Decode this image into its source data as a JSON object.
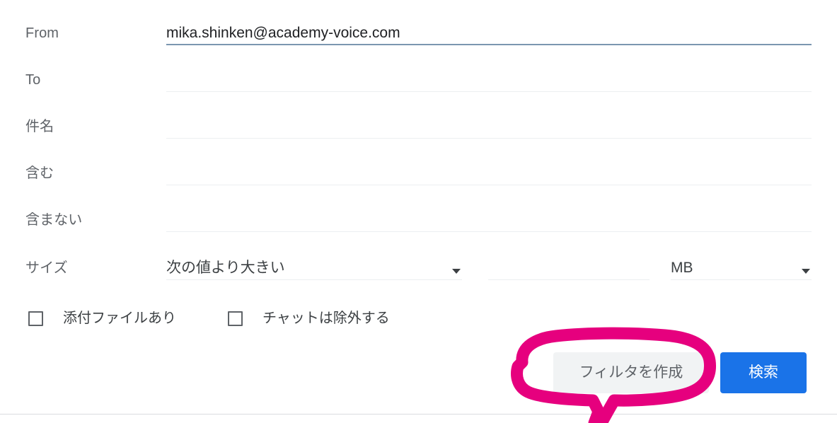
{
  "form": {
    "rows": [
      {
        "label": "From",
        "value": "mika.shinken@academy-voice.com",
        "placeholder": "",
        "focused": true
      },
      {
        "label": "To",
        "value": "",
        "placeholder": "",
        "focused": false
      },
      {
        "label": "件名",
        "value": "",
        "placeholder": "",
        "focused": false
      },
      {
        "label": "含む",
        "value": "",
        "placeholder": "",
        "focused": false
      },
      {
        "label": "含まない",
        "value": "",
        "placeholder": "",
        "focused": false
      }
    ],
    "size_row": {
      "label": "サイズ",
      "operator": "次の値より大きい",
      "amount": "",
      "unit": "MB",
      "operator_icon": "chevron-down-icon",
      "unit_icon": "chevron-down-icon"
    },
    "checkboxes": [
      {
        "label": "添付ファイルあり",
        "checked": false
      },
      {
        "label": "チャットは除外する",
        "checked": false
      }
    ],
    "actions": {
      "create_filter_label": "フィルタを作成",
      "search_label": "検索"
    }
  },
  "annotation": {
    "shape": "hand-drawn-speech-balloon",
    "target": "フィルタを作成",
    "color": "#e6007e"
  },
  "colors": {
    "accent_blue": "#1a73e8",
    "annotation_pink": "#e6007e",
    "label_gray": "#5f6368",
    "text_dark": "#202124",
    "field_underline": "#eceff1",
    "field_underline_active": "#7b97b0",
    "button_gray_bg": "#f1f3f4",
    "divider": "#dadce0"
  }
}
